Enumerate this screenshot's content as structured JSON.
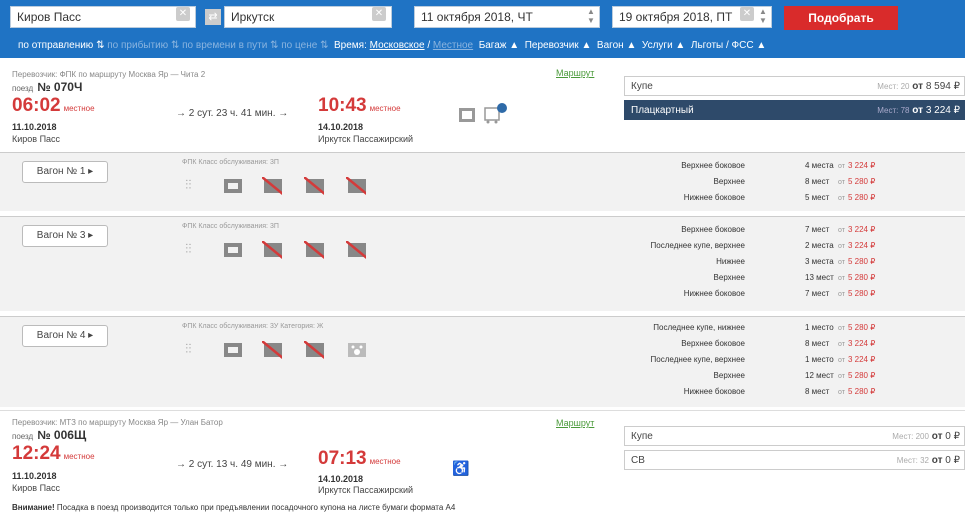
{
  "search": {
    "from": "Киров Пасс",
    "to": "Иркутск",
    "date_there": "11 октября 2018, ЧТ",
    "date_back": "19 октября 2018, ПТ",
    "find_label": "Подобрать"
  },
  "filters": {
    "sort_departure": "по отправлению",
    "sort_arrival": "по прибытию",
    "sort_duration": "по времени в пути",
    "sort_price": "по цене",
    "time_label": "Время:",
    "time_moscow": "Московское",
    "time_local": "Местное",
    "baggage": "Багаж ▲",
    "carrier": "Перевозчик ▲",
    "wagon": "Вагон ▲",
    "services": "Услуги ▲",
    "benefits": "Льготы / ФСС ▲"
  },
  "train1": {
    "carrier": "Перевозчик: ФПК   по маршруту Москва Яр — Чита 2",
    "route_link": "Маршрут",
    "num_prefix": "поезд",
    "number": "№ 070Ч",
    "dep_time": "06:02",
    "dep_tag": "местное",
    "dep_date": "11.10.2018",
    "dep_station": "Киров Пасс",
    "duration": "→ 2 сут. 23 ч. 41 мин. →",
    "arr_time": "10:43",
    "arr_tag": "местное",
    "arr_date": "14.10.2018",
    "arr_station": "Иркутск Пассажирский",
    "classes": [
      {
        "name": "Купе",
        "seats": "Мест: 20",
        "ot": "от",
        "price": "8 594 ₽"
      },
      {
        "name": "Плацкартный",
        "seats": "Мест: 78",
        "ot": "от",
        "price": "3 224 ₽"
      }
    ],
    "wagons": [
      {
        "label": "Вагон  № 1  ▸",
        "meta": "ФПК   Класс обслуживания: 3П",
        "rows": [
          {
            "type": "Верхнее боковое",
            "count": "4 места",
            "ot": "от",
            "price": "3 224 ₽"
          },
          {
            "type": "Верхнее",
            "count": "8 мест",
            "ot": "от",
            "price": "5 280 ₽"
          },
          {
            "type": "Нижнее боковое",
            "count": "5 мест",
            "ot": "от",
            "price": "5 280 ₽"
          }
        ]
      },
      {
        "label": "Вагон  № 3  ▸",
        "meta": "ФПК   Класс обслуживания: 3П",
        "rows": [
          {
            "type": "Верхнее боковое",
            "count": "7 мест",
            "ot": "от",
            "price": "3 224 ₽"
          },
          {
            "type": "Последнее купе, верхнее",
            "count": "2 места",
            "ot": "от",
            "price": "3 224 ₽"
          },
          {
            "type": "Нижнее",
            "count": "3 места",
            "ot": "от",
            "price": "5 280 ₽"
          },
          {
            "type": "Верхнее",
            "count": "13 мест",
            "ot": "от",
            "price": "5 280 ₽"
          },
          {
            "type": "Нижнее боковое",
            "count": "7 мест",
            "ot": "от",
            "price": "5 280 ₽"
          }
        ]
      },
      {
        "label": "Вагон  № 4  ▸",
        "meta": "ФПК   Класс обслуживания: 3У   Категория: Ж",
        "rows": [
          {
            "type": "Последнее купе, нижнее",
            "count": "1 место",
            "ot": "от",
            "price": "5 280 ₽"
          },
          {
            "type": "Верхнее боковое",
            "count": "8 мест",
            "ot": "от",
            "price": "3 224 ₽"
          },
          {
            "type": "Последнее купе, верхнее",
            "count": "1 место",
            "ot": "от",
            "price": "3 224 ₽"
          },
          {
            "type": "Верхнее",
            "count": "12 мест",
            "ot": "от",
            "price": "5 280 ₽"
          },
          {
            "type": "Нижнее боковое",
            "count": "8 мест",
            "ot": "от",
            "price": "5 280 ₽"
          }
        ]
      }
    ]
  },
  "train2": {
    "carrier": "Перевозчик: МТЗ   по маршруту Москва Яр — Улан Батор",
    "route_link": "Маршрут",
    "num_prefix": "поезд",
    "number": "№ 006Щ",
    "dep_time": "12:24",
    "dep_tag": "местное",
    "dep_date": "11.10.2018",
    "dep_station": "Киров Пасс",
    "duration": "→ 2 сут. 13 ч. 49 мин. →",
    "arr_time": "07:13",
    "arr_tag": "местное",
    "arr_date": "14.10.2018",
    "arr_station": "Иркутск Пассажирский",
    "classes": [
      {
        "name": "Купе",
        "seats": "Мест: 200",
        "ot": "от",
        "price": "0 ₽"
      },
      {
        "name": "СВ",
        "seats": "Мест: 32",
        "ot": "от",
        "price": "0 ₽"
      }
    ]
  },
  "notice": {
    "bold": "Внимание!",
    "text": " Посадка в поезд производится только при предъявлении посадочного купона на листе бумаги формата А4"
  },
  "colors": {
    "accent": "#1f73c4",
    "price": "#d43a3a",
    "button": "#d92b2b",
    "link": "#4a9a3a"
  }
}
